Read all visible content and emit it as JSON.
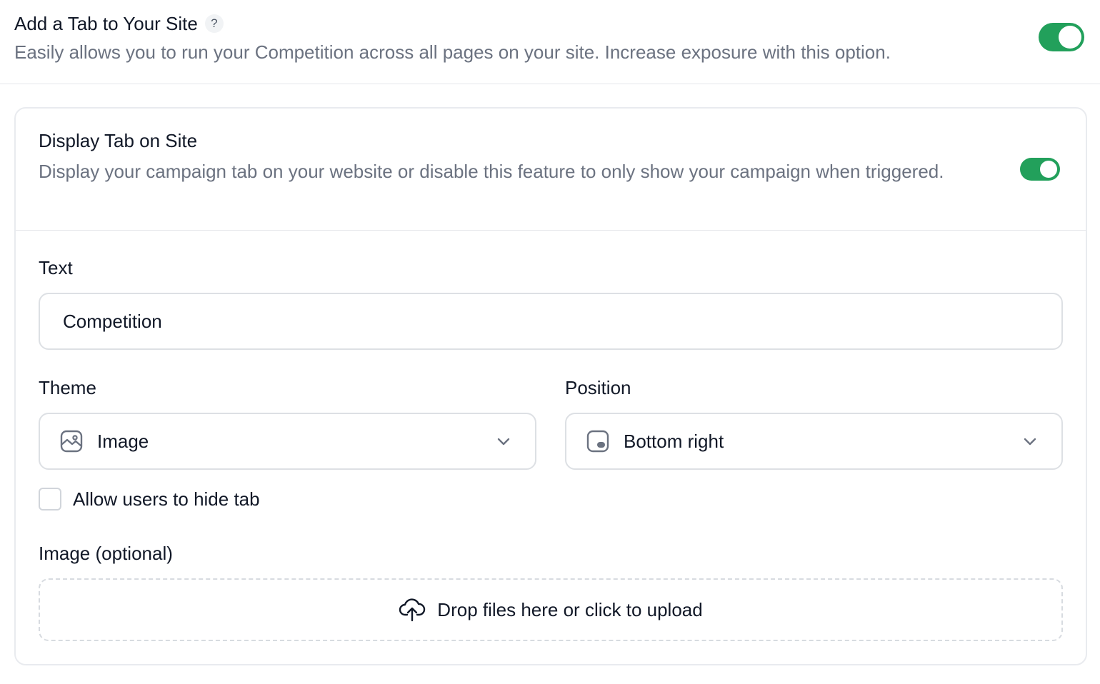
{
  "top": {
    "title": "Add a Tab to Your Site",
    "help": "?",
    "description": "Easily allows you to run your Competition across all pages on your site. Increase exposure with this option.",
    "toggle_on": true
  },
  "card": {
    "title": "Display Tab on Site",
    "description": "Display your campaign tab on your website or disable this feature to only show your campaign when triggered.",
    "toggle_on": true
  },
  "form": {
    "text_label": "Text",
    "text_value": "Competition",
    "theme_label": "Theme",
    "theme_value": "Image",
    "theme_icon": "image-icon",
    "position_label": "Position",
    "position_value": "Bottom right",
    "position_icon": "position-bottom-right-icon",
    "hide_tab_label": "Allow users to hide tab",
    "hide_tab_checked": false,
    "image_label": "Image (optional)",
    "upload_text": "Drop files here or click to upload",
    "upload_icon": "cloud-upload-icon"
  },
  "colors": {
    "toggle_on": "#22a05b",
    "muted_text": "#6b7280",
    "border": "#dde0e4"
  }
}
